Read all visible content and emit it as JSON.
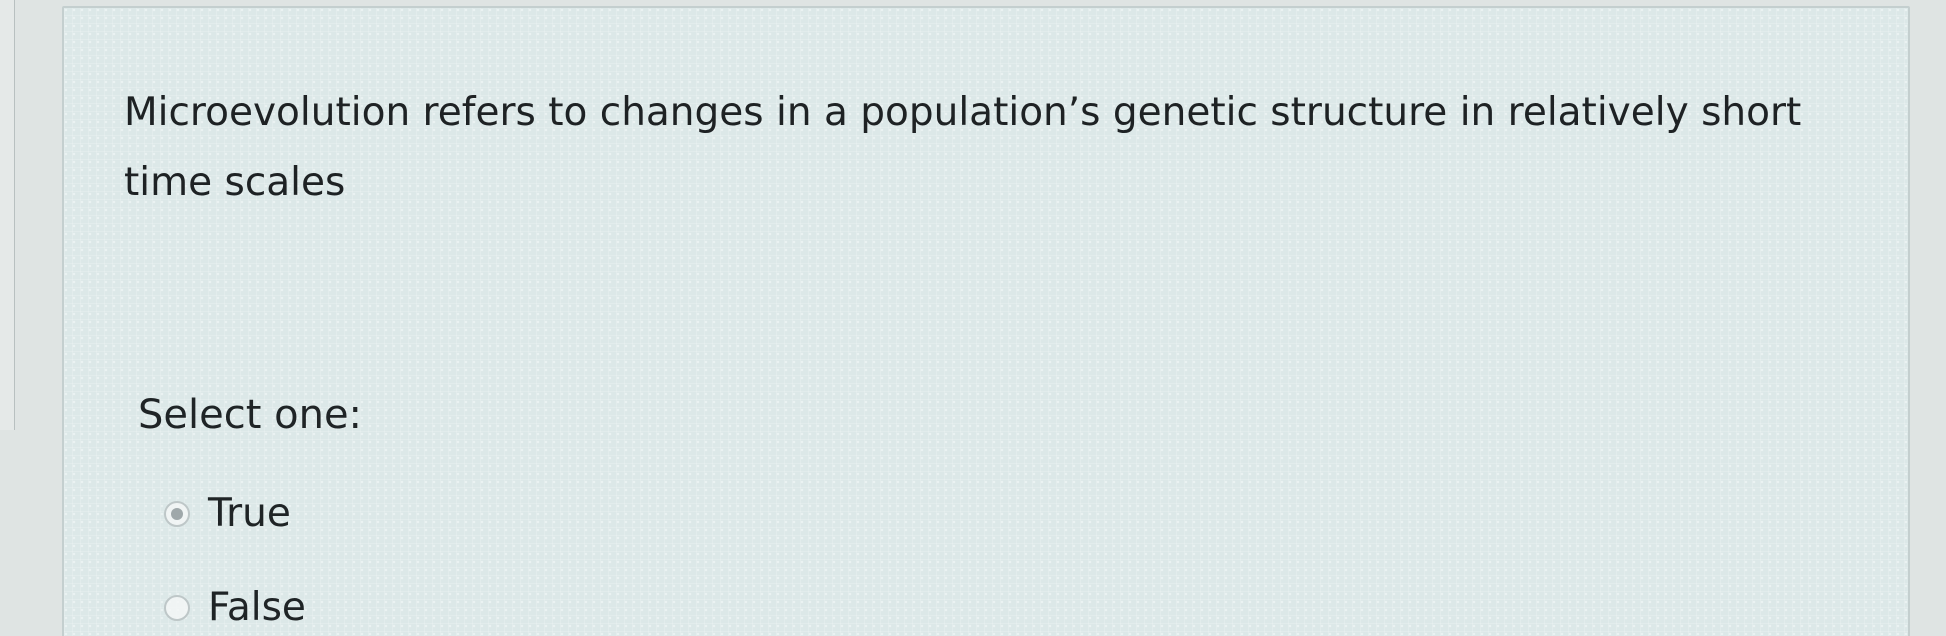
{
  "question": {
    "text": "Microevolution refers to changes in a population’s genetic structure in relatively short time scales"
  },
  "answer_prompt": {
    "label": "Select one:"
  },
  "options": [
    {
      "label": "True",
      "selected": true
    },
    {
      "label": "False",
      "selected": false
    }
  ],
  "colors": {
    "background": "#dfe4e3",
    "card": "#dce8e8",
    "text": "#1f2426",
    "radio_border": "#bec7c8",
    "radio_selected": "#9fa8aa"
  },
  "icons": {
    "selected_radio": "radio-selected-icon",
    "unselected_radio": "radio-unselected-icon"
  }
}
